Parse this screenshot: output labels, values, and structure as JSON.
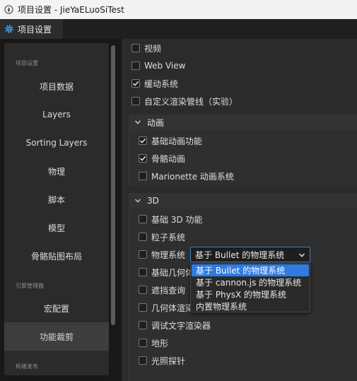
{
  "window": {
    "title": "项目设置 - JieYaELuoSiTest"
  },
  "tab": {
    "label": "项目设置"
  },
  "sidebar": {
    "group_project": "项目设置",
    "group_engine": "引擎管理器",
    "group_build": "构建发布",
    "items": [
      {
        "label": "项目数据"
      },
      {
        "label": "Layers"
      },
      {
        "label": "Sorting Layers"
      },
      {
        "label": "物理"
      },
      {
        "label": "脚本"
      },
      {
        "label": "模型"
      },
      {
        "label": "骨骼贴图布局"
      },
      {
        "label": "宏配置"
      },
      {
        "label": "功能裁剪"
      }
    ],
    "active_item": "功能裁剪"
  },
  "main": {
    "top_rows": [
      {
        "label": "视频",
        "checked": false
      },
      {
        "label": "Web View",
        "checked": false
      },
      {
        "label": "缓动系统",
        "checked": true
      },
      {
        "label": "自定义渲染管线（实验）",
        "checked": false
      }
    ],
    "animation": {
      "title": "动画",
      "rows": [
        {
          "label": "基础动画功能",
          "checked": true
        },
        {
          "label": "骨骼动画",
          "checked": true
        },
        {
          "label": "Marionette 动画系统",
          "checked": false
        }
      ]
    },
    "three_d": {
      "title": "3D",
      "rows": [
        {
          "label": "基础 3D 功能",
          "checked": false
        },
        {
          "label": "粒子系统",
          "checked": false
        },
        {
          "label": "物理系统",
          "checked": false
        },
        {
          "label": "基础几何体",
          "checked": false
        },
        {
          "label": "遮挡查询",
          "checked": false
        },
        {
          "label": "几何体渲染",
          "checked": false
        },
        {
          "label": "调试文字渲染器",
          "checked": false
        },
        {
          "label": "地形",
          "checked": false
        },
        {
          "label": "光照探针",
          "checked": false
        }
      ],
      "physics_select": {
        "value": "基于 Bullet 的物理系统",
        "options": [
          "基于 Bullet 的物理系统",
          "基于 cannon.js 的物理系统",
          "基于 PhysX 的物理系统",
          "内置物理系统"
        ],
        "highlighted": "基于 Bullet 的物理系统"
      }
    }
  },
  "colors": {
    "accent": "#2f7be0",
    "background": "#181818",
    "panel": "#2b2b2b"
  }
}
